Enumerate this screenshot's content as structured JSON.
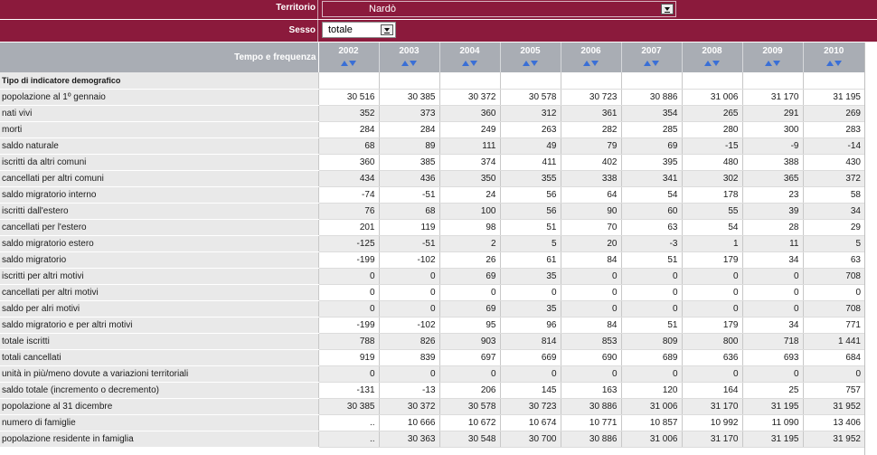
{
  "filters": {
    "territorio_label": "Territorio",
    "territorio_value": "Nardò",
    "sesso_label": "Sesso",
    "sesso_value": "totale"
  },
  "table": {
    "corner_label": "Tempo e frequenza",
    "section_label": "Tipo di indicatore demografico",
    "years": [
      "2002",
      "2003",
      "2004",
      "2005",
      "2006",
      "2007",
      "2008",
      "2009",
      "2010"
    ],
    "rows": [
      {
        "label": "popolazione al 1º gennaio",
        "values": [
          "30 516",
          "30 385",
          "30 372",
          "30 578",
          "30 723",
          "30 886",
          "31 006",
          "31 170",
          "31 195"
        ]
      },
      {
        "label": "nati vivi",
        "values": [
          "352",
          "373",
          "360",
          "312",
          "361",
          "354",
          "265",
          "291",
          "269"
        ]
      },
      {
        "label": "morti",
        "values": [
          "284",
          "284",
          "249",
          "263",
          "282",
          "285",
          "280",
          "300",
          "283"
        ]
      },
      {
        "label": "saldo naturale",
        "values": [
          "68",
          "89",
          "111",
          "49",
          "79",
          "69",
          "-15",
          "-9",
          "-14"
        ]
      },
      {
        "label": "iscritti da altri comuni",
        "values": [
          "360",
          "385",
          "374",
          "411",
          "402",
          "395",
          "480",
          "388",
          "430"
        ]
      },
      {
        "label": "cancellati per altri comuni",
        "values": [
          "434",
          "436",
          "350",
          "355",
          "338",
          "341",
          "302",
          "365",
          "372"
        ]
      },
      {
        "label": "saldo migratorio interno",
        "values": [
          "-74",
          "-51",
          "24",
          "56",
          "64",
          "54",
          "178",
          "23",
          "58"
        ]
      },
      {
        "label": "iscritti dall'estero",
        "values": [
          "76",
          "68",
          "100",
          "56",
          "90",
          "60",
          "55",
          "39",
          "34"
        ]
      },
      {
        "label": "cancellati per l'estero",
        "values": [
          "201",
          "119",
          "98",
          "51",
          "70",
          "63",
          "54",
          "28",
          "29"
        ]
      },
      {
        "label": "saldo migratorio estero",
        "values": [
          "-125",
          "-51",
          "2",
          "5",
          "20",
          "-3",
          "1",
          "11",
          "5"
        ]
      },
      {
        "label": "saldo migratorio",
        "values": [
          "-199",
          "-102",
          "26",
          "61",
          "84",
          "51",
          "179",
          "34",
          "63"
        ]
      },
      {
        "label": "iscritti per altri motivi",
        "values": [
          "0",
          "0",
          "69",
          "35",
          "0",
          "0",
          "0",
          "0",
          "708"
        ]
      },
      {
        "label": "cancellati per altri motivi",
        "values": [
          "0",
          "0",
          "0",
          "0",
          "0",
          "0",
          "0",
          "0",
          "0"
        ]
      },
      {
        "label": "saldo per alri motivi",
        "values": [
          "0",
          "0",
          "69",
          "35",
          "0",
          "0",
          "0",
          "0",
          "708"
        ]
      },
      {
        "label": "saldo migratorio e per altri motivi",
        "values": [
          "-199",
          "-102",
          "95",
          "96",
          "84",
          "51",
          "179",
          "34",
          "771"
        ]
      },
      {
        "label": "totale iscritti",
        "values": [
          "788",
          "826",
          "903",
          "814",
          "853",
          "809",
          "800",
          "718",
          "1 441"
        ]
      },
      {
        "label": "totali cancellati",
        "values": [
          "919",
          "839",
          "697",
          "669",
          "690",
          "689",
          "636",
          "693",
          "684"
        ]
      },
      {
        "label": "unità in più/meno dovute a variazioni territoriali",
        "values": [
          "0",
          "0",
          "0",
          "0",
          "0",
          "0",
          "0",
          "0",
          "0"
        ]
      },
      {
        "label": "saldo totale (incremento o decremento)",
        "values": [
          "-131",
          "-13",
          "206",
          "145",
          "163",
          "120",
          "164",
          "25",
          "757"
        ]
      },
      {
        "label": "popolazione al 31 dicembre",
        "values": [
          "30 385",
          "30 372",
          "30 578",
          "30 723",
          "30 886",
          "31 006",
          "31 170",
          "31 195",
          "31 952"
        ]
      },
      {
        "label": "numero di famiglie",
        "values": [
          "..",
          "10 666",
          "10 672",
          "10 674",
          "10 771",
          "10 857",
          "10 992",
          "11 090",
          "13 406"
        ]
      },
      {
        "label": "popolazione residente in famiglia",
        "values": [
          "..",
          "30 363",
          "30 548",
          "30 700",
          "30 886",
          "31 006",
          "31 170",
          "31 195",
          "31 952"
        ]
      }
    ]
  },
  "colors": {
    "filter_bar": "#8b1a3c",
    "header_bar": "#a9adb4",
    "sort_arrow": "#3a6fd6",
    "label_column": "#e9e9e9"
  }
}
